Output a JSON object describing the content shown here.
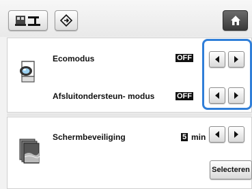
{
  "toolbar": {
    "machine_icon": "sewing-machine-icon",
    "diamond_icon": "diamond-arrow-icon",
    "home_icon": "home-icon"
  },
  "settings": {
    "eco": {
      "label": "Ecomodus",
      "value": "OFF",
      "icon": "eco-mode-icon"
    },
    "shutoff": {
      "label": "Afsluitondersteun- modus",
      "value": "OFF"
    },
    "screensaver": {
      "label": "Schermbeveiliging",
      "value": "5",
      "unit": "min",
      "icon": "screensaver-icon",
      "select_label": "Selecteren"
    }
  },
  "colors": {
    "highlight": "#2f7ed8",
    "badge_bg": "#111111",
    "home_button": "#3a3a3a"
  }
}
